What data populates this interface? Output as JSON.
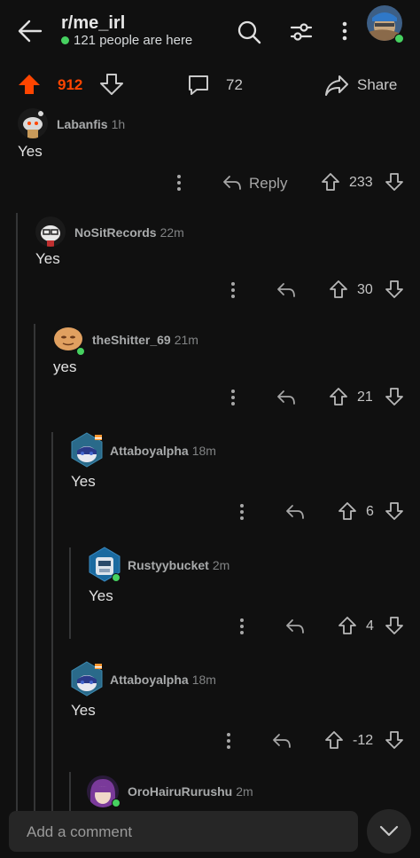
{
  "header": {
    "subreddit": "r/me_irl",
    "presence": "121 people are here"
  },
  "post_actions": {
    "score": "912",
    "comments": "72",
    "share": "Share"
  },
  "comments": [
    {
      "user": "Labanfis",
      "age": "1h",
      "text": "Yes",
      "score": "233",
      "reply": "Reply"
    },
    {
      "user": "NoSitRecords",
      "age": "22m",
      "text": "Yes",
      "score": "30"
    },
    {
      "user": "theShitter_69",
      "age": "21m",
      "text": "yes",
      "score": "21"
    },
    {
      "user": "Attaboyalpha",
      "age": "18m",
      "text": "Yes",
      "score": "6"
    },
    {
      "user": "Rustyybucket",
      "age": "2m",
      "text": "Yes",
      "score": "4"
    },
    {
      "user": "Attaboyalpha",
      "age": "18m",
      "text": "Yes",
      "score": "-12"
    },
    {
      "user": "OroHairuRurushu",
      "age": "2m"
    }
  ],
  "composer": {
    "placeholder": "Add a comment"
  },
  "colors": {
    "background": "#101010",
    "upvote_active": "#ff4500",
    "online": "#46d160",
    "thread_line": "#343536"
  },
  "icons": [
    "back-arrow-icon",
    "search-icon",
    "filter-icon",
    "more-vertical-icon",
    "upvote-icon",
    "downvote-icon",
    "comment-icon",
    "share-icon",
    "reply-icon",
    "chevron-down-icon"
  ]
}
